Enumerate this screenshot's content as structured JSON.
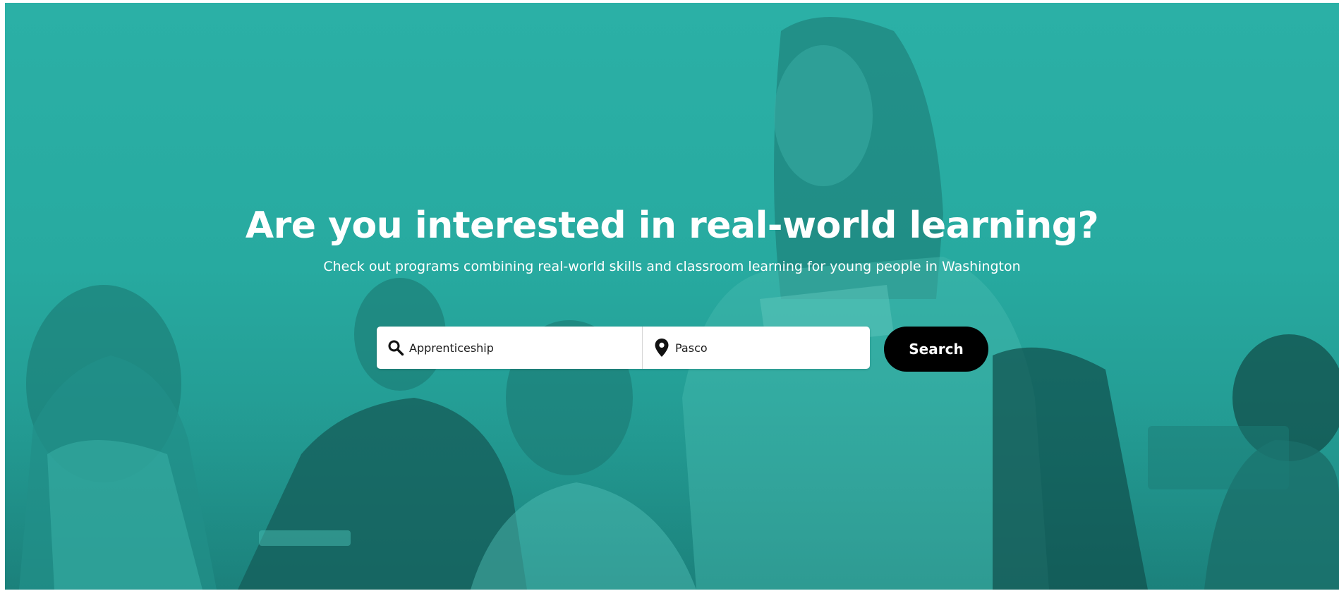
{
  "hero": {
    "headline": "Are you interested in real-world learning?",
    "subheadline": "Check out programs combining real-world skills and classroom learning for young people in Washington",
    "background_color": "#2bb0a6"
  },
  "search": {
    "keyword_value": "Apprenticeship",
    "keyword_icon": "search-icon",
    "location_value": "Pasco",
    "location_icon": "map-pin-icon",
    "button_label": "Search"
  }
}
